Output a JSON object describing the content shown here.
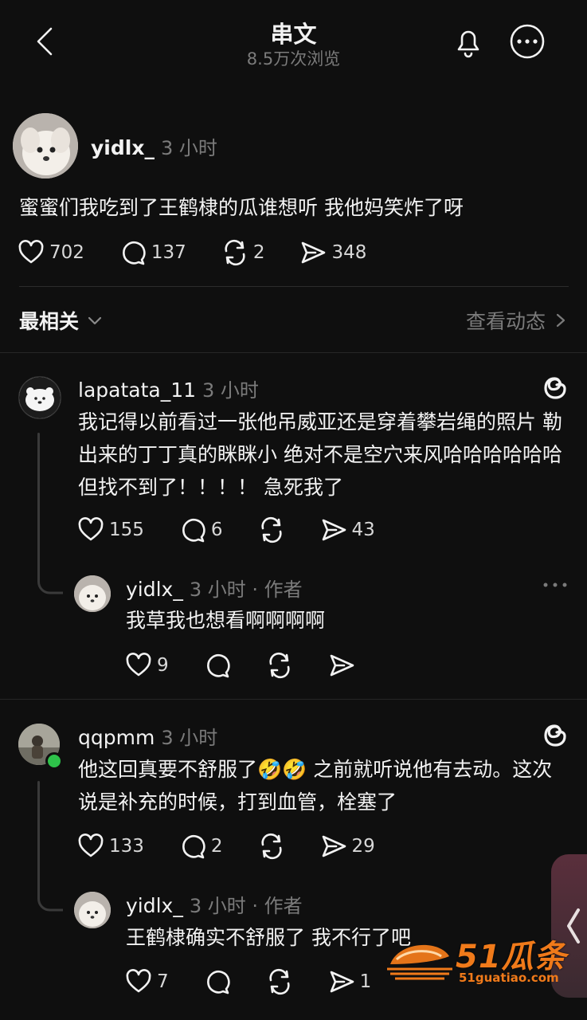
{
  "header": {
    "title": "串文",
    "views": "8.5万次浏览"
  },
  "post": {
    "username": "yidlx_",
    "time": "3 小时",
    "text": "蜜蜜们我吃到了王鹤棣的瓜谁想听 我他妈笑炸了呀",
    "likes": "702",
    "comments": "137",
    "reposts": "2",
    "shares": "348"
  },
  "filter": {
    "sort_label": "最相关",
    "activity_label": "查看动态"
  },
  "replies": [
    {
      "username": "lapatata_11",
      "time": "3 小时",
      "text": "我记得以前看过一张他吊威亚还是穿着攀岩绳的照片 勒出来的丁丁真的眯眯小 绝对不是空穴来风哈哈哈哈哈哈 但找不到了！！！！ 急死我了",
      "likes": "155",
      "comments": "6",
      "shares": "43",
      "sub": {
        "username": "yidlx_",
        "meta": "3 小时 · 作者",
        "text": "我草我也想看啊啊啊啊",
        "likes": "9"
      }
    },
    {
      "username": "qqpmm",
      "time": "3 小时",
      "text_a": "他这回真要不舒服了",
      "emoji": "🤣🤣",
      "text_b": " 之前就听说他有去动。这次说是补充的时候，打到血管，栓塞了",
      "likes": "133",
      "comments": "2",
      "shares": "29",
      "sub": {
        "username": "yidlx_",
        "meta": "3 小时 · 作者",
        "text": "王鹤棣确实不舒服了 我不行了吧",
        "likes": "7",
        "shares": "1"
      }
    }
  ],
  "watermark": {
    "brand": "51瓜条",
    "url": "51guatiao.com"
  },
  "colors": {
    "background": "#0f0f0f",
    "text": "#f2f2f2",
    "muted": "#7b7b7b",
    "online": "#2ec24a",
    "watermark": "#f07a1a"
  }
}
